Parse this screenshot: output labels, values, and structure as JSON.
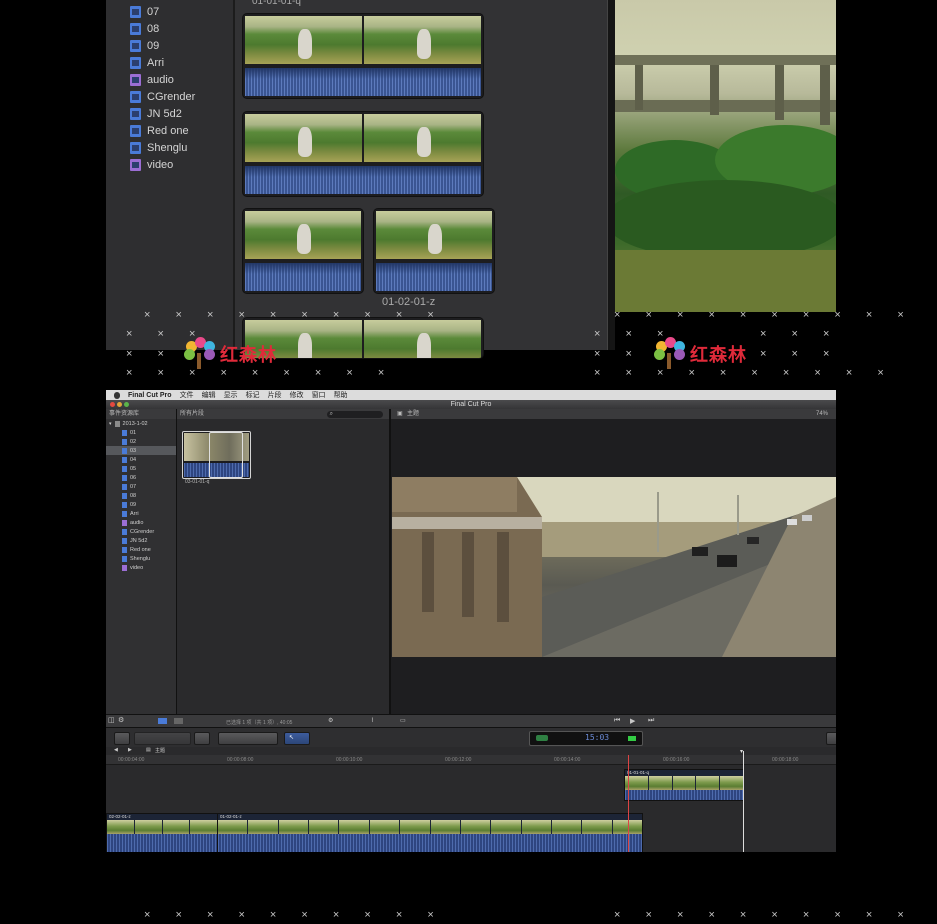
{
  "top": {
    "events": [
      {
        "label": "07",
        "icon": "event-icon"
      },
      {
        "label": "08",
        "icon": "event-icon"
      },
      {
        "label": "09",
        "icon": "event-icon"
      },
      {
        "label": "Arri",
        "icon": "event-icon"
      },
      {
        "label": "audio",
        "icon": "keyword-collection-icon"
      },
      {
        "label": "CGrender",
        "icon": "event-icon"
      },
      {
        "label": "JN 5d2",
        "icon": "event-icon"
      },
      {
        "label": "Red one",
        "icon": "event-icon"
      },
      {
        "label": "Shenglu",
        "icon": "event-icon"
      },
      {
        "label": "video",
        "icon": "keyword-collection-icon"
      }
    ],
    "clip_label_top": "01-01-01-q",
    "clip_label_small": "01-02-01-z"
  },
  "watermark": {
    "text": "红森林"
  },
  "app": {
    "menubar": {
      "app_name": "Final Cut Pro",
      "items": [
        "文件",
        "编辑",
        "显示",
        "标记",
        "片段",
        "修改",
        "窗口",
        "帮助"
      ]
    },
    "window_title": "Final Cut Pro",
    "library": {
      "header": "事件资源库",
      "root": "2013-1-02",
      "events": [
        "01",
        "02",
        "03",
        "04",
        "05",
        "06",
        "07",
        "08",
        "09",
        "Arri",
        "audio",
        "CGrender",
        "JN 5d2",
        "Red one",
        "Shenglu",
        "video"
      ],
      "selected": "03"
    },
    "browser": {
      "header": "所有片段",
      "clip_name": "03-01-01-q",
      "status": "已选择 1 项（共 1 项）, 40:05"
    },
    "viewer": {
      "header": "主题",
      "zoom": "74%"
    },
    "toolbar": {
      "timecode": "15:03"
    },
    "timeline": {
      "project": "主题",
      "ruler": [
        "00:00:04:00",
        "00:00:08:00",
        "00:00:10:00",
        "00:00:12:00",
        "00:00:14:00",
        "00:00:16:00",
        "00:00:18:00"
      ],
      "clips": [
        {
          "name": "02-02-01-z"
        },
        {
          "name": "01-02-01-z"
        },
        {
          "name": "01-01-01-q"
        }
      ]
    }
  }
}
